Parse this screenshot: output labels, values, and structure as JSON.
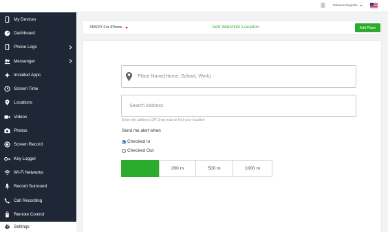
{
  "sidebar": {
    "items": [
      {
        "label": "My Devices",
        "icon": "phone-icon"
      },
      {
        "label": "Dashboard",
        "icon": "dashboard-icon"
      },
      {
        "label": "Phone Logs",
        "icon": "phone-icon",
        "has_submenu": true
      },
      {
        "label": "Messenger",
        "icon": "users-icon",
        "has_submenu": true
      },
      {
        "label": "Installed Apps",
        "icon": "apps-icon"
      },
      {
        "label": "Screen Time",
        "icon": "clock-icon"
      },
      {
        "label": "Locations",
        "icon": "map-pin-icon"
      },
      {
        "label": "Videos",
        "icon": "video-icon"
      },
      {
        "label": "Photos",
        "icon": "camera-icon"
      },
      {
        "label": "Screen Record",
        "icon": "record-icon"
      },
      {
        "label": "Key Logger",
        "icon": "keyboard-icon"
      },
      {
        "label": "Wi-Fi Networks",
        "icon": "wifi-icon"
      },
      {
        "label": "Record Surround",
        "icon": "microphone-icon"
      },
      {
        "label": "Call Recording",
        "icon": "phone-call-icon"
      },
      {
        "label": "Remote Control",
        "icon": "remote-icon"
      }
    ],
    "settings_label": "Settings"
  },
  "topbar": {
    "user_name": "Yohanes Nugroho"
  },
  "subheader": {
    "device_name": "XNSPY For iPhone",
    "title": "Add Watchlist Location",
    "add_button": "Add Place"
  },
  "form": {
    "place_placeholder": "Place Name(Home, School, Work)",
    "address_placeholder": "Search Address",
    "hint": "Enter the address OR Drag map to find your location",
    "alert_label": "Send me alert when",
    "options": [
      {
        "label": "Checked In",
        "selected": true
      },
      {
        "label": "Checked Out",
        "selected": false
      }
    ],
    "radius_options": [
      "",
      "200 m",
      "500 m",
      "1000 m"
    ],
    "radius_selected_index": 0
  },
  "colors": {
    "sidebar_bg": "#1f2736",
    "accent_green": "#2dab2d",
    "title_green": "#3cae3c",
    "radio_blue": "#2d6fcf"
  }
}
